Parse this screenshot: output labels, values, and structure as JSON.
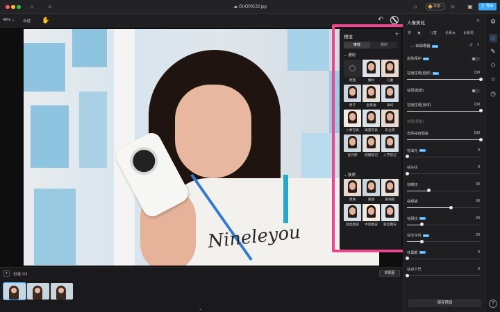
{
  "window": {
    "title": "GUO00132.jpg"
  },
  "titlebar": {
    "vip_label": "充值",
    "export_label": "导出"
  },
  "toolbar": {
    "zoom": "40%",
    "fit_label": "合适"
  },
  "filmstrip": {
    "add_label": "+",
    "selected_label": "已选",
    "count": "1/3",
    "view_mode": "单视图",
    "thumb_badges": [
      "",
      "",
      ""
    ]
  },
  "presets": {
    "title": "预设",
    "add_icon": "+",
    "tabs": [
      "推荐",
      "我的"
    ],
    "section_general": "通用",
    "section_style": "肤质",
    "general_items": [
      "原图",
      "婚纱",
      "儿童",
      "亲子",
      "全家福",
      "孕妇",
      "入像写真",
      "闺蜜写真",
      "毕业照",
      "证件照",
      "结婚登记",
      "入学登记"
    ],
    "style_items": [
      "原肤",
      "质感",
      "玻璃肌",
      "轻度磨皮",
      "中度磨皮",
      "重度磨皮"
    ]
  },
  "right_panel": {
    "title": "人像美化",
    "tabs": [
      "男",
      "女",
      "儿童",
      "长辈女",
      "长辈男"
    ],
    "section": "去除瑕疵",
    "section_badge": "New",
    "rows": [
      {
        "label": "皮肤保护",
        "badge": "New",
        "type": "toggle",
        "value": ""
      },
      {
        "label": "祛痘祛斑(脸部)",
        "badge": "New",
        "type": "slider",
        "value": "100",
        "level": 1.0
      },
      {
        "label": "祛斑(脸部)",
        "badge": "",
        "type": "toggle",
        "value": ""
      },
      {
        "label": "祛痘祛斑(身体)",
        "badge": "",
        "type": "slider",
        "value": "100",
        "level": 1.0
      },
      {
        "label": "祛斑(颈部)",
        "badge": "",
        "type": "text",
        "value": ""
      },
      {
        "label": "去除祛痘瑕疵",
        "badge": "",
        "type": "slider",
        "value": "100",
        "level": 1.0
      },
      {
        "label": "祛油光",
        "badge": "New",
        "type": "slider",
        "value": "0",
        "level": 0.0
      },
      {
        "label": "祛头纹",
        "badge": "",
        "type": "slider",
        "value": "0",
        "level": 0.0
      },
      {
        "label": "祛眼纹",
        "badge": "",
        "type": "slider",
        "value": "30",
        "level": 0.3
      },
      {
        "label": "祛眼袋",
        "badge": "",
        "type": "slider",
        "value": "60",
        "level": 0.6
      },
      {
        "label": "祛颈纹",
        "badge": "New",
        "type": "slider",
        "value": "20",
        "level": 0.2
      },
      {
        "label": "祛法令纹",
        "badge": "New",
        "type": "slider",
        "value": "20",
        "level": 0.2
      },
      {
        "label": "祛黑眼",
        "badge": "New",
        "type": "slider",
        "value": "0",
        "level": 0.0
      },
      {
        "label": "祛双下巴",
        "badge": "",
        "type": "slider",
        "value": "0",
        "level": 0.0
      }
    ],
    "save_label": "保存预设"
  },
  "tool_strip": {
    "icons": [
      "adjust-icon",
      "portrait-beauty-icon",
      "retouch-icon",
      "mask-icon",
      "crop-icon",
      "history-icon",
      "help-icon"
    ],
    "help_label": "?"
  }
}
